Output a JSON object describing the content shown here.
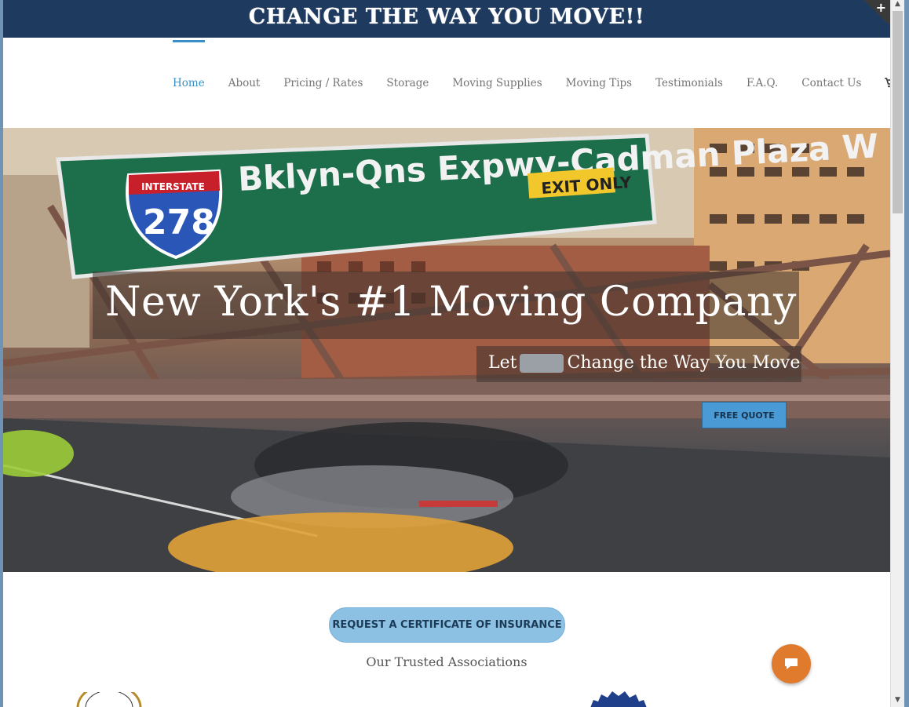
{
  "banner": {
    "title": "CHANGE THE WAY YOU MOVE!!",
    "corner_label": "+"
  },
  "nav": {
    "items": [
      {
        "label": "Home",
        "active": true
      },
      {
        "label": "About",
        "active": false
      },
      {
        "label": "Pricing / Rates",
        "active": false
      },
      {
        "label": "Storage",
        "active": false
      },
      {
        "label": "Moving Supplies",
        "active": false
      },
      {
        "label": "Moving Tips",
        "active": false
      },
      {
        "label": "Testimonials",
        "active": false
      },
      {
        "label": "F.A.Q.",
        "active": false
      },
      {
        "label": "Contact Us",
        "active": false
      }
    ],
    "icons": [
      "cart-icon",
      "search-icon"
    ]
  },
  "hero": {
    "headline": "New York's #1 Moving Company",
    "subline_prefix": "Let",
    "subline_suffix": "Change the Way You Move",
    "quote_button": "FREE QUOTE",
    "sign_text": "Bklyn-Qns Expwy-Cadman Plaza W",
    "shield_top": "INTERSTATE",
    "shield_number": "278",
    "exit_text": "EXIT ONLY"
  },
  "certificate_button": "REQUEST A CERTIFICATE OF INSURANCE",
  "associations_title": "Our Trusted Associations",
  "colors": {
    "banner": "#1f3a5f",
    "accent": "#3a90c6",
    "chat": "#e07a2d"
  }
}
